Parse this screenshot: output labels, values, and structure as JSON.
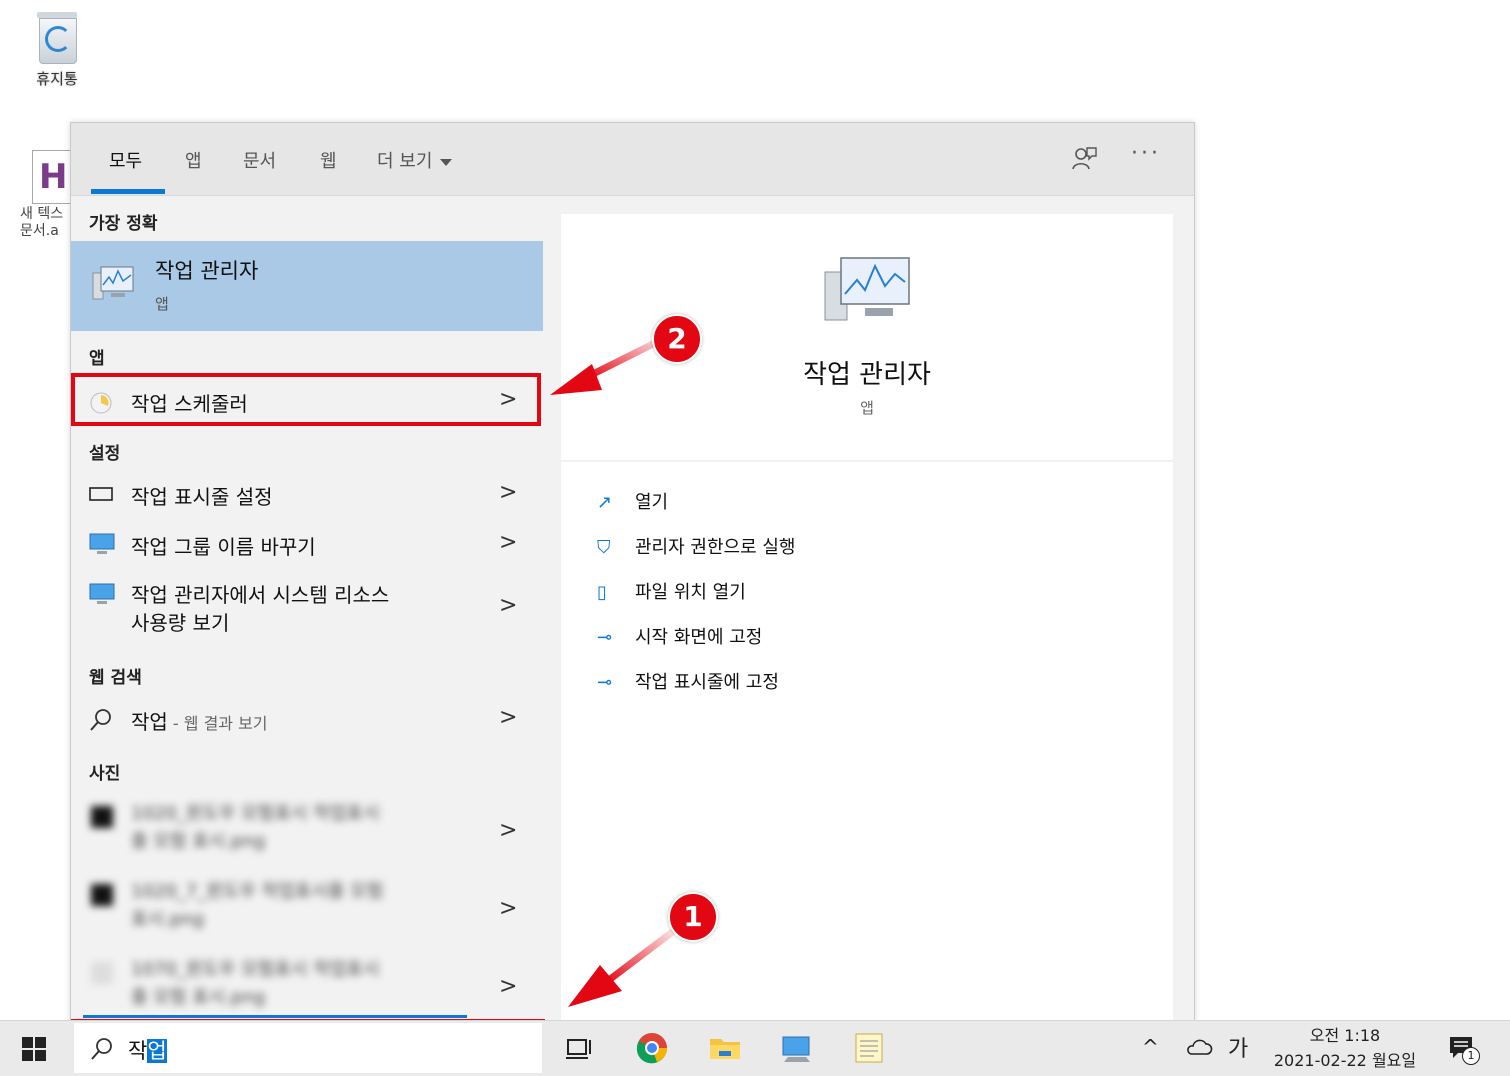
{
  "desktop": {
    "recycle_bin_label": "휴지통",
    "hwp_label_line1": "새 텍스",
    "hwp_label_line2": "문서.a"
  },
  "tabs": [
    {
      "label": "모두"
    },
    {
      "label": "앱"
    },
    {
      "label": "문서"
    },
    {
      "label": "웹"
    },
    {
      "label": "더 보기"
    }
  ],
  "more_label": "···",
  "sections": {
    "best_match": "가장 정확",
    "apps": "앱",
    "settings": "설정",
    "web": "웹 검색",
    "photos": "사진"
  },
  "best_match": {
    "title": "작업 관리자",
    "subtitle": "앱"
  },
  "apps": [
    {
      "label": "작업 스케줄러"
    }
  ],
  "settings": [
    {
      "label": "작업 표시줄 설정"
    },
    {
      "label": "작업 그룹 이름 바꾸기"
    },
    {
      "label_line1": "작업 관리자에서 시스템 리소스",
      "label_line2": "사용량 보기"
    }
  ],
  "web": {
    "query": "작업",
    "suffix": " - 웹 결과 보기"
  },
  "photos": [
    {
      "line1": "1020_윈도우 모험표시 작업표시",
      "line2": "줄 모험 표시.png"
    },
    {
      "line1": "1020_7_윈도우 작업표시줄 모험",
      "line2": "표시.png"
    },
    {
      "line1": "1070_윈도우 모험표시 작업표시",
      "line2": "줄 모험 표시.png"
    }
  ],
  "preview": {
    "title": "작업 관리자",
    "subtitle": "앱",
    "actions": [
      {
        "label": "열기"
      },
      {
        "label": "관리자 권한으로 실행"
      },
      {
        "label": "파일 위치 열기"
      },
      {
        "label": "시작 화면에 고정"
      },
      {
        "label": "작업 표시줄에 고정"
      }
    ]
  },
  "badges": {
    "one": "1",
    "two": "2"
  },
  "taskbar": {
    "search_text_normal": "작",
    "search_text_selected": "업",
    "ime_label": "가",
    "clock_time": "오전 1:18",
    "clock_date": "2021-02-22 월요일",
    "notification_count": "1"
  },
  "colors": {
    "accent": "#0a78d4",
    "highlight_red": "#e30613",
    "best_match_bg": "#a9c9e6"
  }
}
